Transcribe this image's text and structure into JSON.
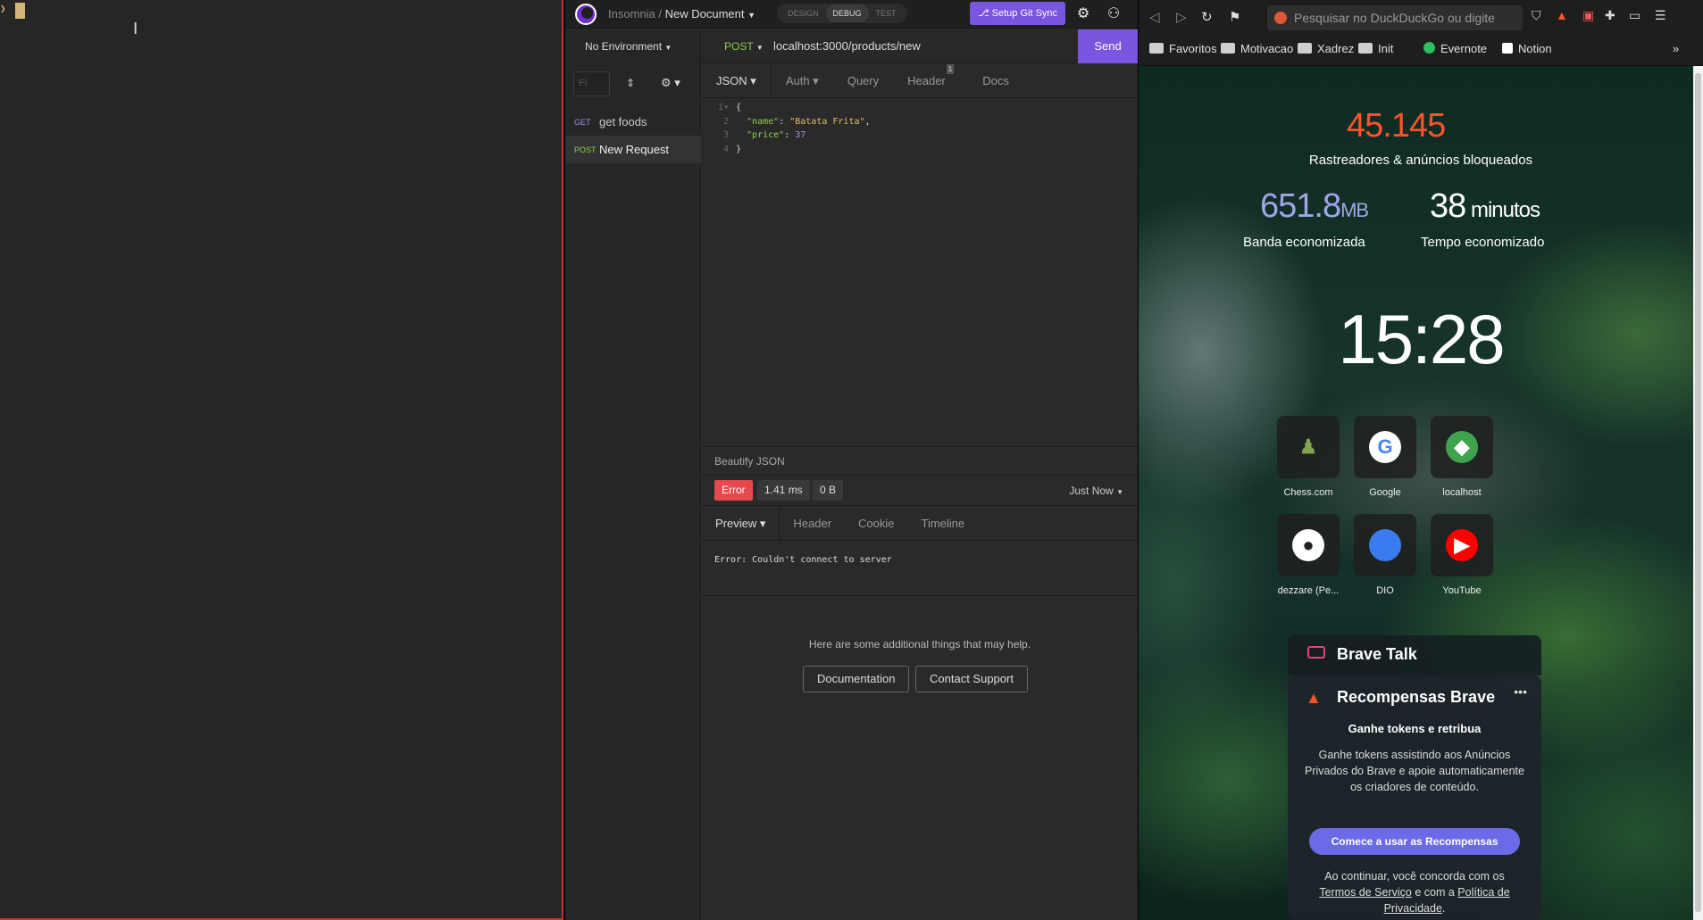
{
  "terminal": {
    "prompt": "❯",
    "ibeam": "I"
  },
  "insomnia": {
    "app_name": "Insomnia",
    "separator": "/",
    "document": "New Document",
    "modes": [
      "DESIGN",
      "DEBUG",
      "TEST"
    ],
    "git_button": "⎇ Setup Git Sync",
    "environment": "No Environment",
    "filter_placeholder": "Fi",
    "requests": [
      {
        "method": "GET",
        "name": "get foods",
        "method_color": "#a58be8"
      },
      {
        "method": "POST",
        "name": "New Request",
        "method_color": "#8ccf4a"
      }
    ],
    "request": {
      "method": "POST",
      "url": "localhost:3000/products/new",
      "send": "Send"
    },
    "body_tabs": [
      {
        "label": "JSON",
        "active": true,
        "dropdown": true
      },
      {
        "label": "Auth",
        "dropdown": true
      },
      {
        "label": "Query"
      },
      {
        "label": "Header",
        "badge": "1"
      },
      {
        "label": "Docs"
      }
    ],
    "code_lines": [
      {
        "n": "1▾",
        "parts": [
          [
            "p",
            "{"
          ]
        ]
      },
      {
        "n": "2",
        "parts": [
          [
            "k",
            "  \"name\""
          ],
          [
            "p",
            ": "
          ],
          [
            "s",
            "\"Batata Frita\""
          ],
          [
            "p",
            ","
          ]
        ]
      },
      {
        "n": "3",
        "parts": [
          [
            "k",
            "  \"price\""
          ],
          [
            "p",
            ": "
          ],
          [
            "n",
            "37"
          ]
        ]
      },
      {
        "n": "4",
        "parts": [
          [
            "p",
            "}"
          ]
        ]
      }
    ],
    "beautify": "Beautify JSON",
    "status": {
      "error": "Error",
      "time": "1.41 ms",
      "size": "0 B",
      "when": "Just Now"
    },
    "response_tabs": [
      {
        "label": "Preview",
        "active": true,
        "dropdown": true
      },
      {
        "label": "Header"
      },
      {
        "label": "Cookie"
      },
      {
        "label": "Timeline"
      }
    ],
    "error_message": "Error: Couldn't connect to server",
    "help_text": "Here are some additional things that may help.",
    "help_buttons": [
      "Documentation",
      "Contact Support"
    ]
  },
  "brave": {
    "address_placeholder": "Pesquisar no DuckDuckGo ou digite",
    "bookmarks": [
      "Favoritos",
      "Motivacao",
      "Xadrez",
      "Init",
      "Evernote",
      "Notion"
    ],
    "more": "»",
    "stats": {
      "trackers_value": "45.145",
      "trackers_label": "Rastreadores & anúncios bloqueados",
      "bandwidth_value": "651.8",
      "bandwidth_unit": "MB",
      "bandwidth_label": "Banda economizada",
      "time_value": "38",
      "time_unit": "minutos",
      "time_label": "Tempo economizado"
    },
    "clock": "15:28",
    "tiles": [
      {
        "label": "Chess.com",
        "icon": "chess-pawn-icon",
        "glyph": "♟",
        "color": "#7fa650",
        "bg": "transparent"
      },
      {
        "label": "Google",
        "icon": "google-icon",
        "glyph": "G",
        "color": "#4285f4",
        "bg": "#ffffff"
      },
      {
        "label": "localhost",
        "icon": "leaf-icon",
        "glyph": "◆",
        "color": "#ffffff",
        "bg": "#3fa34d"
      },
      {
        "label": "dezzare (Pe...",
        "icon": "github-icon",
        "glyph": "●",
        "color": "#222222",
        "bg": "#ffffff"
      },
      {
        "label": "DIO",
        "icon": "dio-icon",
        "glyph": "",
        "color": "#ffffff",
        "bg": "#3a7bf0"
      },
      {
        "label": "YouTube",
        "icon": "youtube-icon",
        "glyph": "▶",
        "color": "#ffffff",
        "bg": "#ff0000"
      }
    ],
    "brave_talk": "Brave Talk",
    "rewards": {
      "title": "Recompensas Brave",
      "menu": "•••",
      "subtitle": "Ganhe tokens e retribua",
      "body": "Ganhe tokens assistindo aos Anúncios Privados do Brave e apoie automaticamente os criadores de conteúdo.",
      "button": "Comece a usar as Recompensas",
      "footer_pre": "Ao continuar, você concorda com os",
      "terms": "Termos de Serviço",
      "footer_mid": " e com a ",
      "privacy": "Política de Privacidade",
      "footer_end": "."
    },
    "colors": {
      "trackers": "#fb542b",
      "bandwidth": "#a0a5eb",
      "accent": "#7a55e0"
    }
  }
}
